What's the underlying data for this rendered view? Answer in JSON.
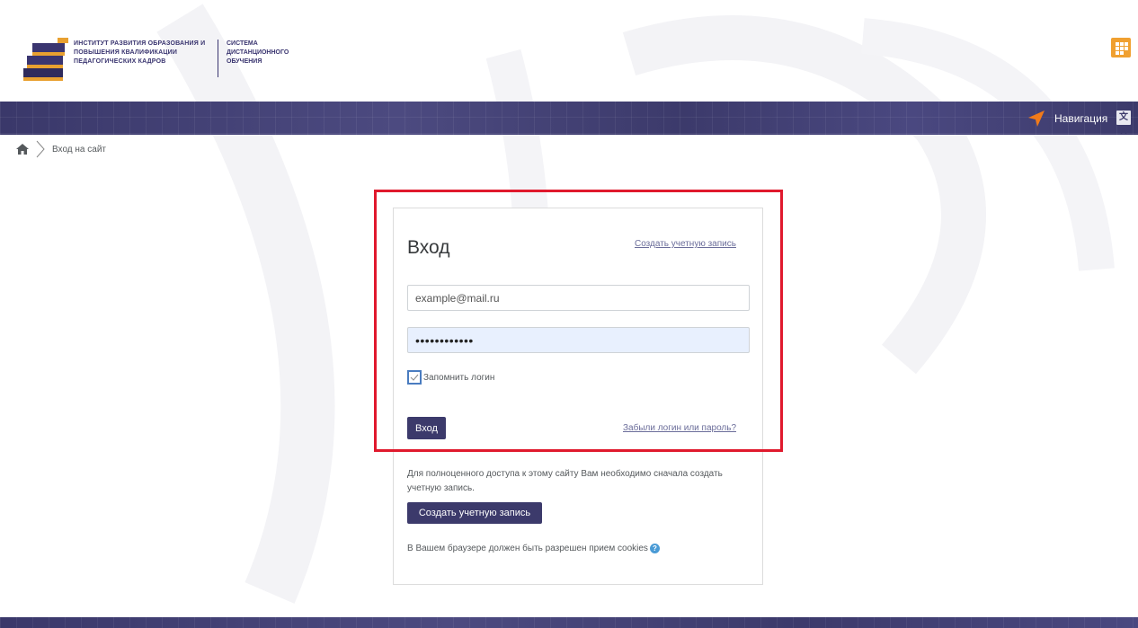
{
  "header": {
    "org_name": "Институт развития образования и повышения квалификации педагогических кадров",
    "system_name": "Система дистанционного обучения",
    "apps_icon": "grid-icon"
  },
  "navbar": {
    "nav_label": "Навигация",
    "nav_icon": "navigation-arrow-icon",
    "lang_icon": "translate-icon",
    "lang_glyph": "文A"
  },
  "breadcrumb": {
    "home_icon": "home-icon",
    "current": "Вход на сайт"
  },
  "login": {
    "title": "Вход",
    "create_account_link": "Создать учетную запись",
    "username_value": "example@mail.ru",
    "password_value": "••••••••••••",
    "remember_label": "Запомнить логин",
    "remember_checked": true,
    "submit_label": "Вход",
    "forgot_link": "Забыли логин или пароль?"
  },
  "signup": {
    "info_text": "Для полноценного доступа к этому сайту Вам необходимо сначала создать учетную запись.",
    "button_label": "Создать учетную запись"
  },
  "cookies": {
    "text": "В Вашем браузере должен быть разрешен прием cookies",
    "help_icon": "help-icon",
    "help_glyph": "?"
  },
  "colors": {
    "brand": "#3c3a6b",
    "highlight": "#e0192d",
    "accent": "#f0a030"
  }
}
